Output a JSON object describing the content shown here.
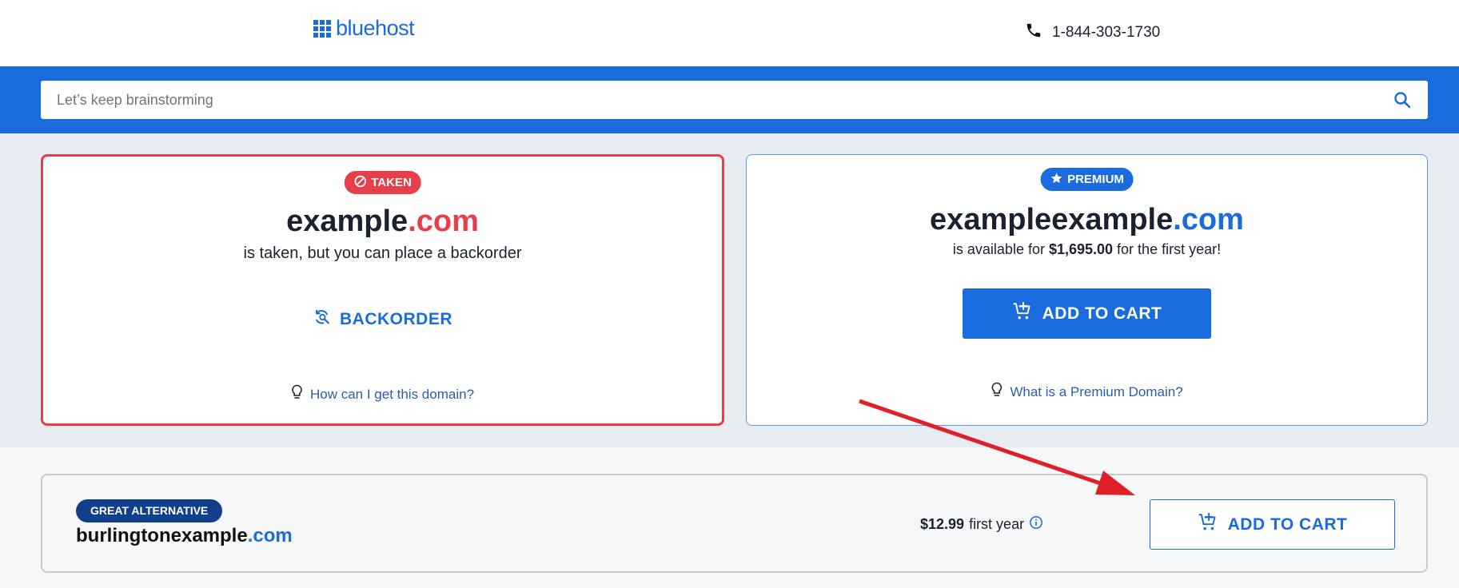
{
  "header": {
    "logo_text": "bluehost",
    "phone": "1-844-303-1730"
  },
  "search": {
    "placeholder": "Let’s keep brainstorming",
    "value": ""
  },
  "taken_card": {
    "badge": "TAKEN",
    "domain_name": "example",
    "domain_tld": ".com",
    "subtitle": "is taken, but you can place a backorder",
    "action_label": "BACKORDER",
    "help_link": "How can I get this domain?"
  },
  "premium_card": {
    "badge": "PREMIUM",
    "domain_name": "exampleexample",
    "domain_tld": ".com",
    "subtitle_prefix": "is available for ",
    "price": "$1,695.00",
    "subtitle_suffix": " for the first year!",
    "action_label": "ADD TO CART",
    "help_link": "What is a Premium Domain?"
  },
  "alternative": {
    "badge": "GREAT ALTERNATIVE",
    "domain_name": "burlingtonexample",
    "domain_tld": ".com",
    "price": "$12.99",
    "price_suffix": "first year",
    "action_label": "ADD TO CART"
  },
  "colors": {
    "brand_blue": "#196bde",
    "taken_red": "#e63f4a",
    "badge_navy": "#123f8c",
    "annotation_arrow": "#e01f26"
  },
  "icons": {
    "logo": "grid-icon",
    "phone": "phone-icon",
    "search": "search-icon",
    "taken": "ban-icon",
    "premium": "star-icon",
    "backorder": "backorder-refresh-icon",
    "help": "lightbulb-icon",
    "cart": "cart-plus-icon",
    "info": "info-icon"
  }
}
